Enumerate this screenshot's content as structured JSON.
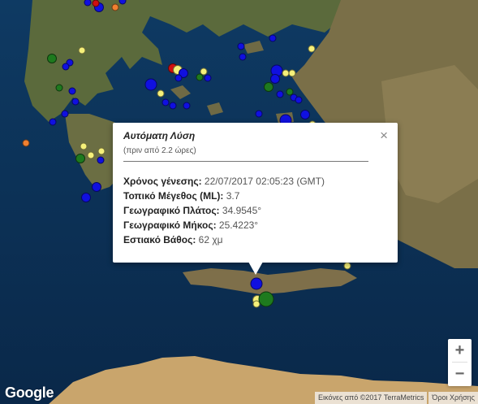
{
  "map": {
    "type": "satellite",
    "region": "Aegean Sea and Crete",
    "colors": {
      "blue": "#1010e0",
      "yellow": "#f5f07a",
      "green": "#1e7a1e",
      "orange": "#f08030",
      "red": "#d01010"
    }
  },
  "quakes": [
    {
      "color": "blue",
      "size": "m"
    },
    {
      "color": "blue",
      "size": "s"
    },
    {
      "color": "red",
      "size": "s"
    },
    {
      "color": "orange",
      "size": "s"
    },
    {
      "color": "blue",
      "size": "s"
    },
    {
      "color": "yellow",
      "size": "s"
    },
    {
      "color": "blue",
      "size": "s"
    },
    {
      "color": "green",
      "size": "m"
    },
    {
      "color": "blue",
      "size": "s"
    },
    {
      "color": "green",
      "size": "s"
    },
    {
      "color": "blue",
      "size": "s"
    },
    {
      "color": "blue",
      "size": "s"
    },
    {
      "color": "blue",
      "size": "s"
    },
    {
      "color": "blue",
      "size": "s"
    },
    {
      "color": "blue",
      "size": "l"
    },
    {
      "color": "red",
      "size": "m"
    },
    {
      "color": "yellow",
      "size": "m"
    },
    {
      "color": "blue",
      "size": "m"
    },
    {
      "color": "yellow",
      "size": "s"
    },
    {
      "color": "green",
      "size": "s"
    },
    {
      "color": "blue",
      "size": "s"
    },
    {
      "color": "blue",
      "size": "s"
    },
    {
      "color": "yellow",
      "size": "s"
    },
    {
      "color": "blue",
      "size": "s"
    },
    {
      "color": "blue",
      "size": "s"
    },
    {
      "color": "blue",
      "size": "s"
    },
    {
      "color": "blue",
      "size": "l"
    },
    {
      "color": "yellow",
      "size": "s"
    },
    {
      "color": "blue",
      "size": "m"
    },
    {
      "color": "green",
      "size": "m"
    },
    {
      "color": "yellow",
      "size": "s"
    },
    {
      "color": "blue",
      "size": "s"
    },
    {
      "color": "blue",
      "size": "s"
    },
    {
      "color": "blue",
      "size": "s"
    },
    {
      "color": "blue",
      "size": "s"
    },
    {
      "color": "blue",
      "size": "s"
    },
    {
      "color": "green",
      "size": "s"
    },
    {
      "color": "blue",
      "size": "s"
    },
    {
      "color": "blue",
      "size": "s"
    },
    {
      "color": "yellow",
      "size": "s"
    },
    {
      "color": "orange",
      "size": "s"
    },
    {
      "color": "green",
      "size": "m"
    },
    {
      "color": "yellow",
      "size": "s"
    },
    {
      "color": "yellow",
      "size": "s"
    },
    {
      "color": "blue",
      "size": "m"
    },
    {
      "color": "blue",
      "size": "m"
    },
    {
      "color": "blue",
      "size": "l"
    },
    {
      "color": "blue",
      "size": "m"
    },
    {
      "color": "yellow",
      "size": "s"
    },
    {
      "color": "yellow",
      "size": "m"
    },
    {
      "color": "yellow",
      "size": "s"
    },
    {
      "color": "blue",
      "size": "l"
    },
    {
      "color": "green",
      "size": "xl"
    },
    {
      "color": "yellow",
      "size": "s"
    },
    {
      "color": "blue",
      "size": "s"
    },
    {
      "color": "blue",
      "size": "s"
    },
    {
      "color": "yellow",
      "size": "s"
    }
  ],
  "info": {
    "title": "Αυτόματη Λύση",
    "subtitle": "(πριν από 2.2 ώρες)",
    "close": "×",
    "rows": [
      {
        "label": "Χρόνος γένεσης:",
        "value": " 22/07/2017  02:05:23 (GMT)"
      },
      {
        "label": "Τοπικό Μέγεθος (ML):",
        "value": " 3.7"
      },
      {
        "label": "Γεωγραφικό Πλάτος:",
        "value": " 34.9545°"
      },
      {
        "label": "Γεωγραφικό Μήκος:",
        "value": " 25.4223°"
      },
      {
        "label": "Εστιακό Βάθος:",
        "value": " 62 χμ"
      }
    ]
  },
  "controls": {
    "zoom_in": "+",
    "zoom_out": "−"
  },
  "footer": {
    "logo": "Google",
    "imagery": "Εικόνες από ©2017 TerraMetrics",
    "terms": "Όροι Χρήσης"
  }
}
